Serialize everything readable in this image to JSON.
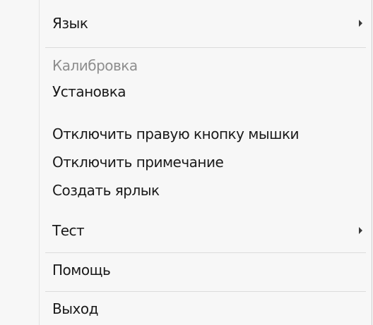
{
  "menu": {
    "items": [
      {
        "label": "Язык",
        "submenu": true,
        "enabled": true
      },
      {
        "label": "Калибровка",
        "submenu": false,
        "enabled": false
      },
      {
        "label": "Установка",
        "submenu": false,
        "enabled": true
      },
      {
        "label": "Отключить правую кнопку мышки",
        "submenu": false,
        "enabled": true
      },
      {
        "label": "Отключить примечание",
        "submenu": false,
        "enabled": true
      },
      {
        "label": "Создать ярлык",
        "submenu": false,
        "enabled": true
      },
      {
        "label": "Тест",
        "submenu": true,
        "enabled": true
      },
      {
        "label": "Помощь",
        "submenu": false,
        "enabled": true
      },
      {
        "label": "Выход",
        "submenu": false,
        "enabled": true
      }
    ],
    "submenu_icon": "chevron-right-icon",
    "colors": {
      "background": "#f7f7f7",
      "text": "#1a1a1a",
      "disabled_text": "#8e8e8e",
      "separator": "#dcdcdc"
    }
  }
}
